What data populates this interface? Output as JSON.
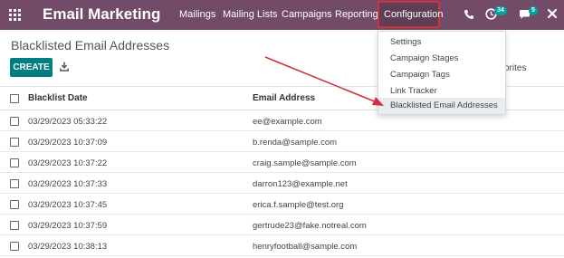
{
  "app": {
    "title": "Email Marketing"
  },
  "nav": {
    "menus": [
      "Mailings",
      "Mailing Lists",
      "Campaigns",
      "Reporting"
    ],
    "configuration": "Configuration",
    "activity_count": "34",
    "message_count": "5"
  },
  "page": {
    "title": "Blacklisted Email Addresses"
  },
  "toolbar": {
    "create_label": "CREATE",
    "favorites_label": "vorites"
  },
  "dropdown": {
    "items": [
      "Settings",
      "Campaign Stages",
      "Campaign Tags",
      "Link Tracker",
      "Blacklisted Email Addresses"
    ],
    "active_index": 4
  },
  "table": {
    "columns": [
      "Blacklist Date",
      "Email Address"
    ],
    "rows": [
      [
        "03/29/2023 05:33:22",
        "ee@example.com"
      ],
      [
        "03/29/2023 10:37:09",
        "b.renda@sample.com"
      ],
      [
        "03/29/2023 10:37:22",
        "craig.sample@sample.com"
      ],
      [
        "03/29/2023 10:37:33",
        "darron123@example.net"
      ],
      [
        "03/29/2023 10:37:45",
        "erica.f.sample@test.org"
      ],
      [
        "03/29/2023 10:37:59",
        "gertrude23@fake.notreal.com"
      ],
      [
        "03/29/2023 10:38:13",
        "henryfootball@sample.com"
      ]
    ]
  },
  "colors": {
    "navbar": "#714b67",
    "primary_button": "#017e84",
    "highlight": "#d0323d",
    "badge": "#00a09d"
  },
  "icons": [
    "apps-icon",
    "phone-icon",
    "activity-icon",
    "chat-icon",
    "close-icon",
    "download-icon"
  ]
}
